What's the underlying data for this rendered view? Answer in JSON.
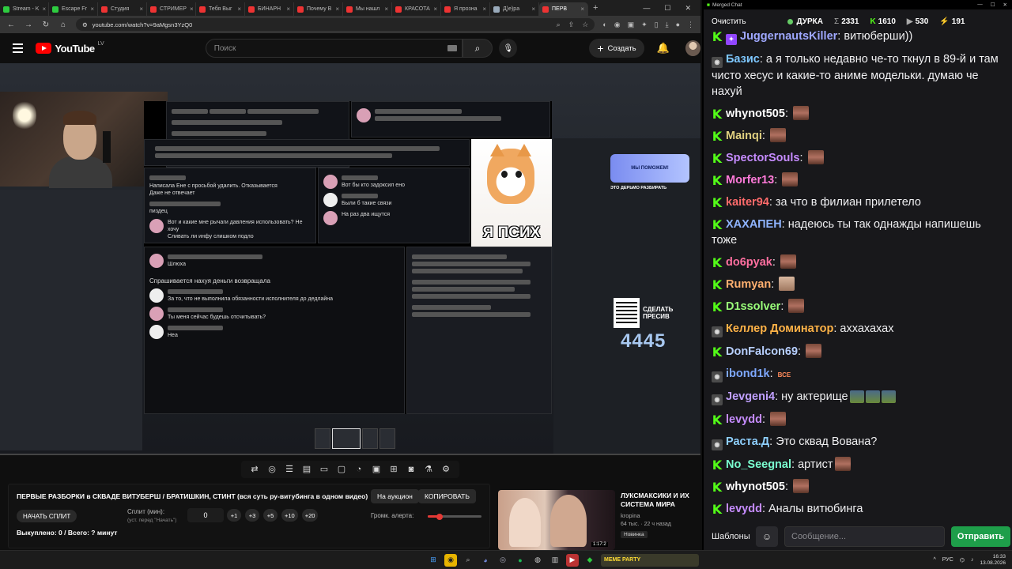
{
  "browser": {
    "tabs": [
      {
        "label": "Stream - K",
        "color": "#2ecc40"
      },
      {
        "label": "Escape Fr",
        "color": "#2ecc40"
      },
      {
        "label": "Студия",
        "color": "#e33"
      },
      {
        "label": "СТРИМЕР",
        "color": "#e33"
      },
      {
        "label": "Тебя Выг",
        "color": "#e33"
      },
      {
        "label": "БИНАРН",
        "color": "#e33"
      },
      {
        "label": "Почему В",
        "color": "#e33"
      },
      {
        "label": "Мы нашл",
        "color": "#e33"
      },
      {
        "label": "КРАСОТА",
        "color": "#e33"
      },
      {
        "label": "Я прозна",
        "color": "#e33"
      },
      {
        "label": "Д)е)ра",
        "color": "#9ab"
      },
      {
        "label": "ПЕРВ",
        "color": "#e33",
        "active": true
      }
    ],
    "url": "youtube.com/watch?v=9aMgsn3YzQ0"
  },
  "youtube": {
    "logo": "YouTube",
    "region": "LV",
    "search_placeholder": "Поиск",
    "create_label": "Создать"
  },
  "video": {
    "kitten_caption": "Я ПСИХ",
    "big_number": "4445",
    "qr_text": "СДЕЛАТЬ ПРЕСИВ",
    "banner_text": "МЫ ПОМОЖЕМ!",
    "overlay_title": "ЭТО ДЕРЬМО РАЗБИРАТЬ",
    "messages": [
      {
        "text": "Шлюха"
      },
      {
        "text": "Спрашивается нахуя деньги возвращала"
      },
      {
        "text": "За то, что не выполнила обязанности исполнителя до дедлайна"
      },
      {
        "text": "Ты меня сейчас будешь отсчитывать?"
      },
      {
        "text": "Неа"
      },
      {
        "text": "Написала Ене с просьбой удалить. Отказывается"
      },
      {
        "text": "Даже не отвечает"
      },
      {
        "text": "Вот бы кто задоксил ено"
      },
      {
        "text": "Были б такие связи"
      },
      {
        "text": "На раз два ищутся"
      },
      {
        "text": "Сливать ли инфу слишком подло"
      },
      {
        "text": "Вот и какие мне рычаги давления использовать? Не хочу"
      },
      {
        "text": "пиздец"
      }
    ]
  },
  "controls": {
    "title": "ПЕРВЫЕ РАЗБОРКИ в СКВАДЕ ВИТУБЕРШ / БРАТИШКИН, СТИНТ (вся суть ру-витубинга в одном видео)",
    "auction_label": "На аукцион",
    "copy_label": "КОПИРОВАТЬ",
    "start_split_label": "НАЧАТЬ СПЛИТ",
    "split_label": "Сплит (мин):",
    "split_sub": "(уст. перед \"Начать\")",
    "split_value": "0",
    "increments": [
      "+1",
      "+3",
      "+5",
      "+10",
      "+20"
    ],
    "volume_label": "Громк. алерта:",
    "volume_level": 0.22,
    "bought_label": "Выкуплено: 0 / Всего: ? минут"
  },
  "recommendation": {
    "title": "ЛУКСМАКСИКИ И ИХ СИСТЕМА МИРА",
    "channel": "kropina",
    "meta": "64 тыс. · 22 ч назад",
    "badge": "Новинка",
    "duration": "1:17:2"
  },
  "chat": {
    "window_title": "Merged Chat",
    "clear_label": "Очистить",
    "channel": "ДУРКА",
    "stats": [
      {
        "sym": "Σ",
        "value": "2331",
        "kind": "sym"
      },
      {
        "sym": "K",
        "value": "1610",
        "kind": "k"
      },
      {
        "sym": "▶",
        "value": "530",
        "kind": "yt"
      },
      {
        "sym": "⚡",
        "value": "191",
        "kind": "yt"
      }
    ],
    "messages": [
      {
        "platform": "kick",
        "user": "JuggernautsKiller",
        "color": "#9fa8ff",
        "text": "витюберши))",
        "emotes": 0,
        "badge": "tw"
      },
      {
        "platform": "yt",
        "user": "Базис",
        "color": "#7ec8ff",
        "text": "а я только недавно че-то ткнул в 89-й и там чисто хесус и какие-то аниме модельки. думаю че нахуй",
        "emotes": 0
      },
      {
        "platform": "kick",
        "user": "whynot505",
        "color": "#ffffff",
        "text": "",
        "emotes": 1
      },
      {
        "platform": "kick",
        "user": "Mainqi",
        "color": "#e0d080",
        "text": "",
        "emotes": 1
      },
      {
        "platform": "kick",
        "user": "SpectorSouls",
        "color": "#c68cff",
        "text": "",
        "emotes": 1
      },
      {
        "platform": "kick",
        "user": "Morfer13",
        "color": "#ff7ad9",
        "text": "",
        "emotes": 1
      },
      {
        "platform": "kick",
        "user": "kaiter94",
        "color": "#ff6b6b",
        "text": "за что в филиан прилетело",
        "emotes": 0
      },
      {
        "platform": "kick",
        "user": "ХАХАПЕН",
        "color": "#8fb4ff",
        "text": "надеюсь ты так однажды напишешь тоже",
        "emotes": 0
      },
      {
        "platform": "kick",
        "user": "do6pyak",
        "color": "#ff6fa0",
        "text": "",
        "emotes": 1
      },
      {
        "platform": "kick",
        "user": "Rumyan",
        "color": "#ffb070",
        "text": "",
        "emotes": 1,
        "face2": true
      },
      {
        "platform": "kick",
        "user": "D1ssolver",
        "color": "#9aff7a",
        "text": "",
        "emotes": 1
      },
      {
        "platform": "yt",
        "user": "Келлер Доминатор",
        "color": "#ffb347",
        "text": "аххахахах",
        "emotes": 0
      },
      {
        "platform": "kick",
        "user": "DonFalcon69",
        "color": "#b8d0ff",
        "text": "",
        "emotes": 1
      },
      {
        "platform": "yt",
        "user": "ibond1k",
        "color": "#7ea8ff",
        "text": "",
        "emotes": 0,
        "bce": "ВСЕ"
      },
      {
        "platform": "yt",
        "user": "Jevgeni4",
        "color": "#c0a0ff",
        "text": "ну актерище",
        "emotes": 3,
        "small": true
      },
      {
        "platform": "kick",
        "user": "levydd",
        "color": "#c68cff",
        "text": "",
        "emotes": 1
      },
      {
        "platform": "yt",
        "user": "Раста.Д",
        "color": "#8fd0ff",
        "text": "Это сквад Вована?",
        "emotes": 0
      },
      {
        "platform": "kick",
        "user": "No_Seegnal",
        "color": "#7affd0",
        "text": "артист",
        "emotes": 1
      },
      {
        "platform": "kick",
        "user": "whynot505",
        "color": "#ffffff",
        "text": "",
        "emotes": 1
      },
      {
        "platform": "kick",
        "user": "levydd",
        "color": "#c68cff",
        "text": "Аналы витюбинга",
        "emotes": 0
      }
    ],
    "templates_label": "Шаблоны",
    "input_placeholder": "Сообщение...",
    "send_label": "Отправить"
  },
  "taskbar": {
    "stream_label": "MEME PARTY",
    "lang": "РУС",
    "time": "16:33",
    "date": "13.08.2026"
  }
}
